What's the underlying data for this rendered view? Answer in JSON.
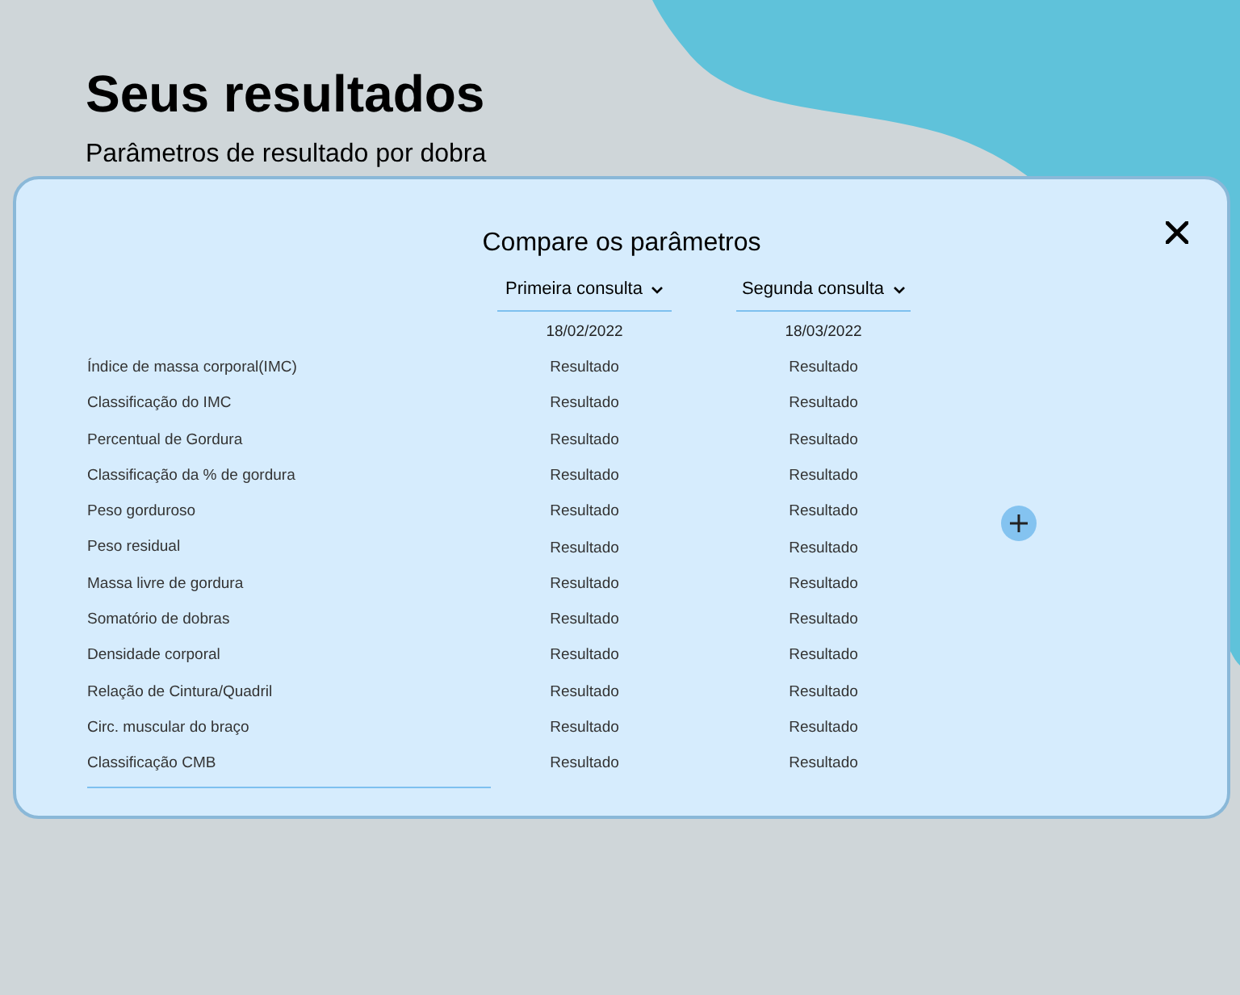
{
  "page": {
    "title": "Seus resultados",
    "subtitle": "Parâmetros de resultado por dobra"
  },
  "modal": {
    "title": "Compare os parâmetros",
    "columns": [
      {
        "label": "Primeira consulta",
        "date": "18/02/2022"
      },
      {
        "label": "Segunda consulta",
        "date": "18/03/2022"
      }
    ],
    "rows": [
      {
        "label": "Índice de massa corporal(IMC)",
        "values": [
          "Resultado",
          "Resultado"
        ]
      },
      {
        "label": "Classificação do IMC",
        "values": [
          "Resultado",
          "Resultado"
        ]
      },
      {
        "label": "Percentual de Gordura",
        "values": [
          "Resultado",
          "Resultado"
        ]
      },
      {
        "label": "Classificação da % de gordura",
        "values": [
          "Resultado",
          "Resultado"
        ]
      },
      {
        "label": "Peso gorduroso",
        "values": [
          "Resultado",
          "Resultado"
        ]
      },
      {
        "label": "Peso residual",
        "values": [
          "Resultado",
          "Resultado"
        ]
      },
      {
        "label": "Massa livre de gordura",
        "values": [
          "Resultado",
          "Resultado"
        ]
      },
      {
        "label": "Somatório de dobras",
        "values": [
          "Resultado",
          "Resultado"
        ]
      },
      {
        "label": "Densidade corporal",
        "values": [
          "Resultado",
          "Resultado"
        ]
      },
      {
        "label": "Relação de Cintura/Quadril",
        "values": [
          "Resultado",
          "Resultado"
        ]
      },
      {
        "label": "Circ. muscular do braço",
        "values": [
          "Resultado",
          "Resultado"
        ]
      },
      {
        "label": "Classificação CMB",
        "values": [
          "Resultado",
          "Resultado"
        ]
      }
    ]
  }
}
